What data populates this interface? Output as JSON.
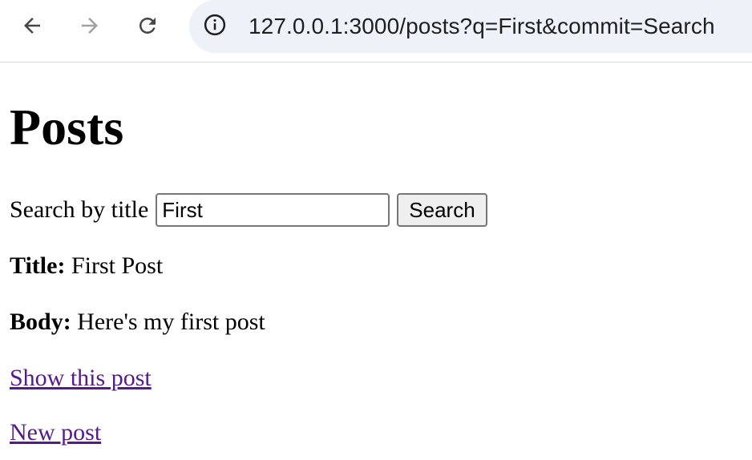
{
  "browser": {
    "url": "127.0.0.1:3000/posts?q=First&commit=Search",
    "icons": {
      "back": "arrow-left-icon",
      "forward": "arrow-right-icon",
      "reload": "reload-icon",
      "site_info": "info-icon"
    },
    "colors": {
      "omnibox_bg": "#eef1f8",
      "forward_disabled": "#a0a0a0"
    }
  },
  "page": {
    "title": "Posts",
    "search": {
      "label": "Search by title",
      "value": "First",
      "button_label": "Search"
    },
    "post": {
      "title_label": "Title:",
      "title_value": "First Post",
      "body_label": "Body:",
      "body_value": "Here's my first post",
      "show_link": "Show this post"
    },
    "new_post_link": "New post",
    "colors": {
      "link": "#551a8b"
    }
  }
}
